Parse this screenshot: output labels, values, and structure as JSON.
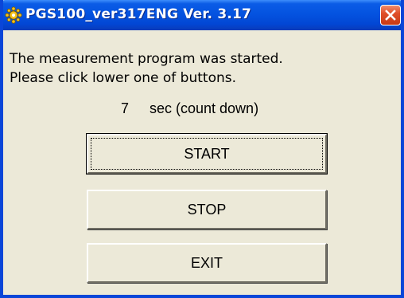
{
  "window": {
    "title": "PGS100_ver317ENG Ver. 3.17"
  },
  "message": {
    "line1": "The measurement program was started.",
    "line2": "Please click lower one of buttons."
  },
  "countdown": {
    "value": "7",
    "label": "sec (count down)"
  },
  "buttons": {
    "start": "START",
    "stop": "STOP",
    "exit": "EXIT"
  },
  "icons": {
    "app": "sun-gear-icon",
    "close": "close-icon"
  },
  "colors": {
    "titlebar": "#0453e0",
    "close_button": "#e0502a",
    "window_bg": "#ece9d8"
  }
}
